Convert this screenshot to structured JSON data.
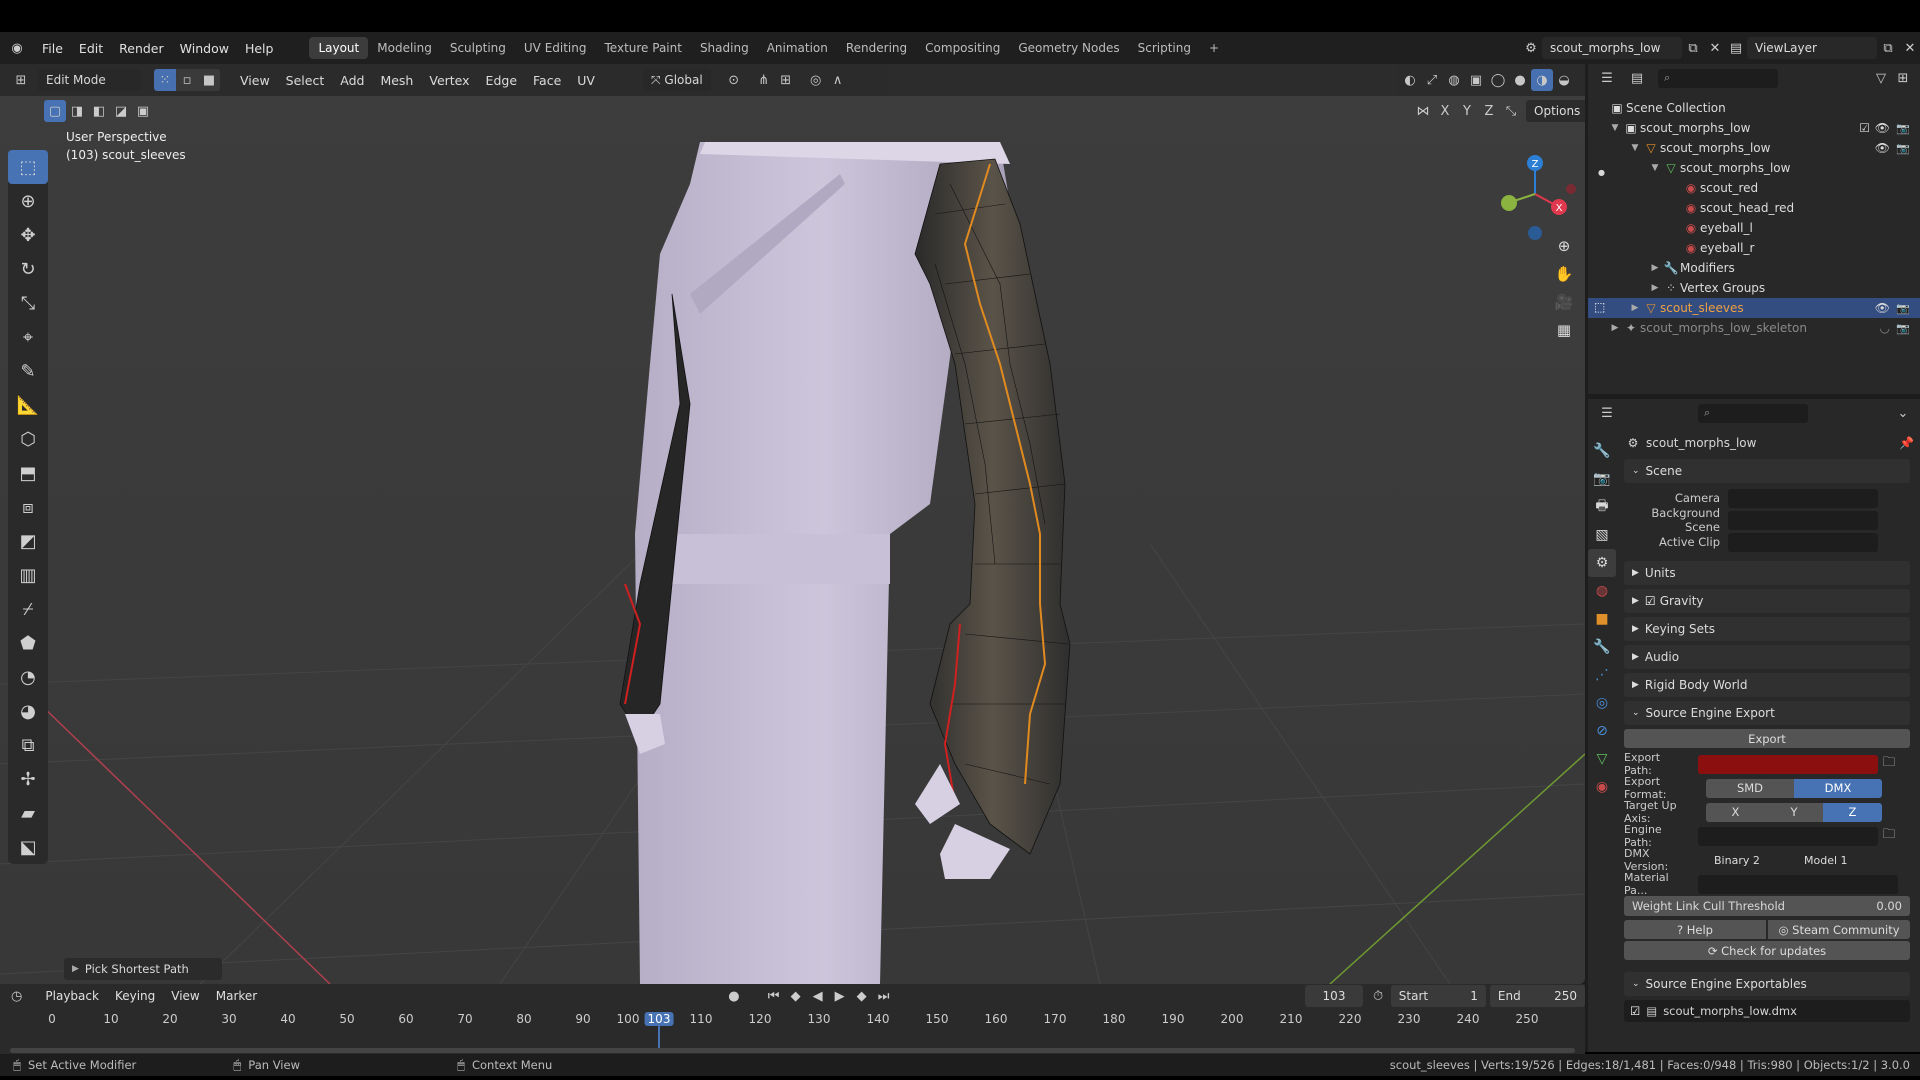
{
  "colors": {
    "accent": "#4772b3",
    "selected": "#334d80",
    "export_path_bg": "#8b0f0f",
    "axis_x": "#e0394e",
    "axis_y": "#8ab33f",
    "axis_z": "#2d7fd6"
  },
  "topbar": {
    "menus": [
      "File",
      "Edit",
      "Render",
      "Window",
      "Help"
    ],
    "workspaces": [
      "Layout",
      "Modeling",
      "Sculpting",
      "UV Editing",
      "Texture Paint",
      "Shading",
      "Animation",
      "Rendering",
      "Compositing",
      "Geometry Nodes",
      "Scripting"
    ],
    "add_workspace": "+",
    "scene_name": "scout_morphs_low",
    "view_layer": "ViewLayer"
  },
  "viewport": {
    "mode": "Edit Mode",
    "menus": [
      "View",
      "Select",
      "Add",
      "Mesh",
      "Vertex",
      "Edge",
      "Face",
      "UV"
    ],
    "orientation": "Global",
    "perspective_label": "User Perspective",
    "object_label": "(103) scout_sleeves",
    "axis_letters": [
      "X",
      "Y",
      "Z"
    ],
    "options_label": "Options",
    "operator_panel": "Pick Shortest Path",
    "gizmo": {
      "z": "Z",
      "x": "X"
    }
  },
  "outliner": {
    "root": "Scene Collection",
    "items": [
      {
        "label": "scout_morphs_low",
        "icon": "collection-icon"
      },
      {
        "label": "scout_morphs_low",
        "icon": "mesh-object-icon"
      },
      {
        "label": "scout_morphs_low",
        "icon": "mesh-data-icon"
      },
      {
        "label": "scout_red",
        "icon": "material-icon"
      },
      {
        "label": "scout_head_red",
        "icon": "material-icon"
      },
      {
        "label": "eyeball_l",
        "icon": "material-icon"
      },
      {
        "label": "eyeball_r",
        "icon": "material-icon"
      },
      {
        "label": "Modifiers",
        "icon": "wrench-icon"
      },
      {
        "label": "Vertex Groups",
        "icon": "vertex-groups-icon"
      },
      {
        "label": "scout_sleeves",
        "icon": "mesh-object-icon"
      },
      {
        "label": "scout_morphs_low_skeleton",
        "icon": "armature-icon"
      }
    ]
  },
  "properties": {
    "scene_name": "scout_morphs_low",
    "scene_panel": "Scene",
    "camera_label": "Camera",
    "background_scene_label": "Background Scene",
    "active_clip_label": "Active Clip",
    "panels": [
      "Units",
      "Gravity",
      "Keying Sets",
      "Audio",
      "Rigid Body World"
    ],
    "source_engine_export": "Source Engine Export",
    "export_button": "Export",
    "export_path_label": "Export Path:",
    "export_format_label": "Export Format:",
    "format_options": [
      "SMD",
      "DMX"
    ],
    "format_selected": "DMX",
    "target_up_label": "Target Up Axis:",
    "up_options": [
      "X",
      "Y",
      "Z"
    ],
    "up_selected": "Z",
    "engine_path_label": "Engine Path:",
    "dmx_version_label": "DMX Version:",
    "dmx_binary": "Binary 2",
    "dmx_model": "Model 1",
    "material_path_label": "Material Pa...",
    "weight_cull_label": "Weight Link Cull Threshold",
    "weight_cull_value": "0.00",
    "help_button": "Help",
    "steam_button": "Steam Community",
    "updates_button": "Check for updates",
    "exportables_panel": "Source Engine Exportables",
    "exportable_item": "scout_morphs_low.dmx"
  },
  "timeline": {
    "menus": [
      "Playback",
      "Keying",
      "View",
      "Marker"
    ],
    "current_frame": "103",
    "start_label": "Start",
    "start_value": "1",
    "end_label": "End",
    "end_value": "250",
    "ticks": [
      "0",
      "10",
      "20",
      "30",
      "40",
      "50",
      "60",
      "70",
      "80",
      "90",
      "100",
      "110",
      "120",
      "130",
      "140",
      "150",
      "160",
      "170",
      "180",
      "190",
      "200",
      "210",
      "220",
      "230",
      "240",
      "250"
    ]
  },
  "statusbar": {
    "left1": "Set Active Modifier",
    "left2": "Pan View",
    "left3": "Context Menu",
    "stats": "scout_sleeves | Verts:19/526 | Edges:18/1,481 | Faces:0/948 | Tris:980 | Objects:1/2 | 3.0.0"
  }
}
